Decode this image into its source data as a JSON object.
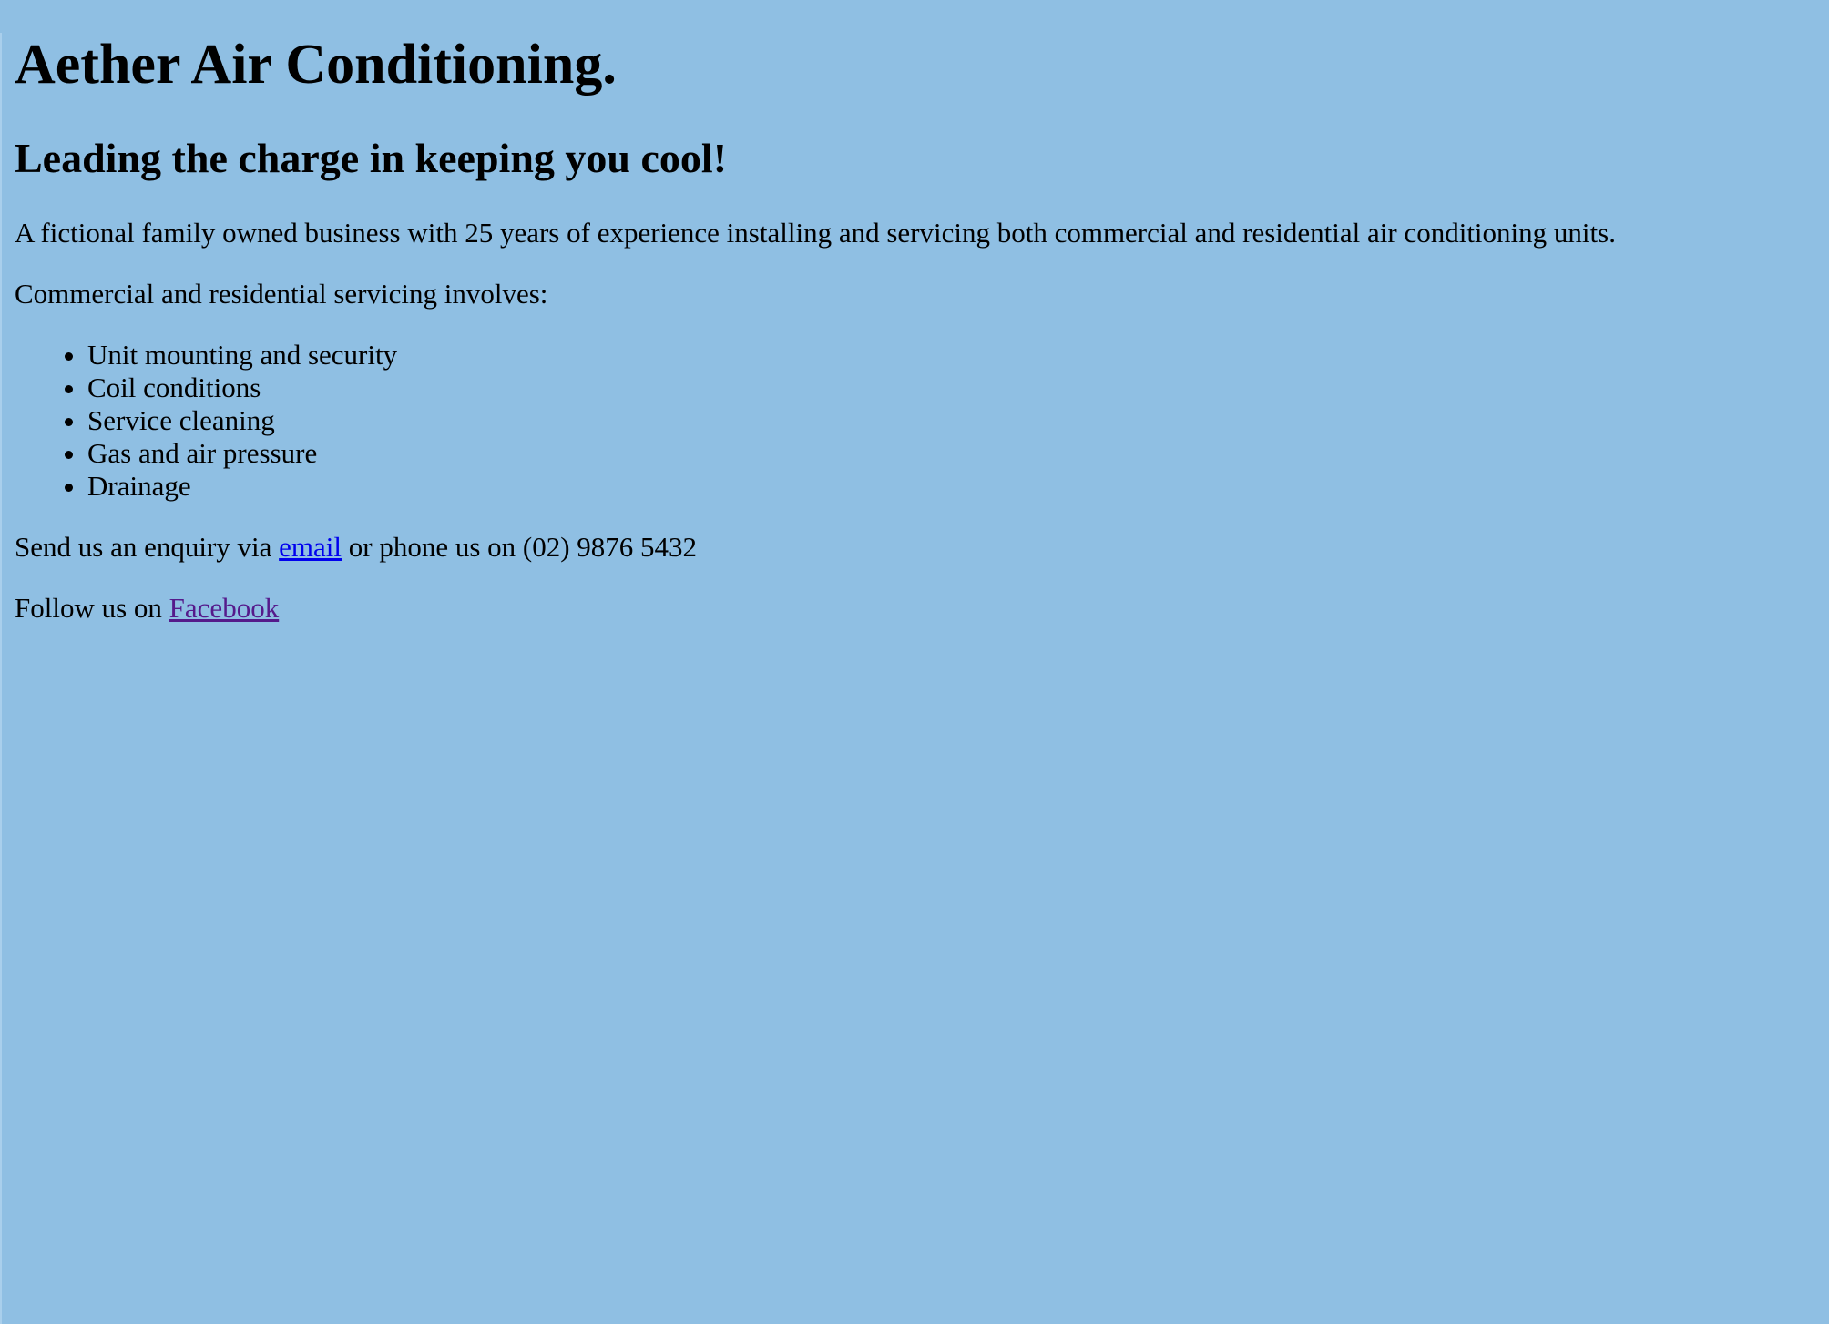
{
  "header": {
    "title": "Aether Air Conditioning.",
    "tagline": "Leading the charge in keeping you cool!"
  },
  "intro": "A fictional family owned business with 25 years of experience installing and servicing both commercial and residential air conditioning units.",
  "services": {
    "heading": "Commercial and residential servicing involves:",
    "items": [
      "Unit mounting and security",
      "Coil conditions",
      "Service cleaning",
      "Gas and air pressure",
      "Drainage"
    ]
  },
  "contact": {
    "prefix": "Send us an enquiry via ",
    "email_link": "email",
    "suffix": " or phone us on (02) 9876 5432"
  },
  "social": {
    "prefix": "Follow us on ",
    "facebook_link": "Facebook"
  },
  "colors": {
    "background": "#8fbfe3",
    "link": "#0000ee",
    "visited_link": "#551a8b"
  }
}
